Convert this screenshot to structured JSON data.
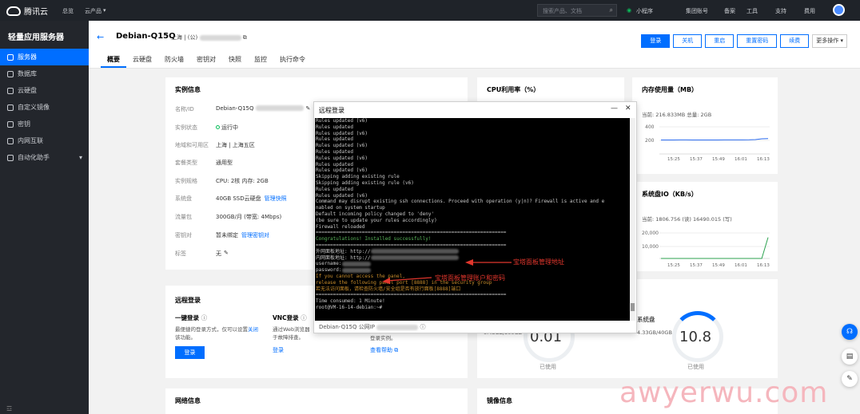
{
  "topbar": {
    "brand": "腾讯云",
    "nav": [
      "总览",
      "云产品"
    ],
    "search_placeholder": "搜索产品、文档",
    "right": [
      "小程序",
      "集团账号",
      "备案",
      "工具",
      "支持",
      "费用"
    ]
  },
  "sidebar": {
    "title": "轻量应用服务器",
    "items": [
      "服务器",
      "数据库",
      "云硬盘",
      "自定义镜像",
      "密钥",
      "内网互联",
      "自动化助手"
    ],
    "bottom": "☲"
  },
  "header": {
    "name": "Debian-Q15Q",
    "region_prefix": "上海 | (公)",
    "tabs": [
      "概要",
      "云硬盘",
      "防火墙",
      "密钥对",
      "快照",
      "监控",
      "执行命令"
    ],
    "actions": [
      "登录",
      "关机",
      "重启",
      "重置密码",
      "续费",
      "更多操作"
    ]
  },
  "instance_card": {
    "title": "实例信息",
    "rows": [
      {
        "k": "名称/ID",
        "v": "Debian-Q15Q"
      },
      {
        "k": "实例状态",
        "v": "运行中"
      },
      {
        "k": "地域和可用区",
        "v": "上海 | 上海五区"
      },
      {
        "k": "套餐类型",
        "v": "通用型"
      },
      {
        "k": "实例规格",
        "v": "CPU: 2核 内存: 2GB"
      },
      {
        "k": "系统盘",
        "v": "40GB SSD云硬盘",
        "link": "管理快照"
      },
      {
        "k": "流量包",
        "v": "300GB/月 (带宽: 4Mbps)"
      },
      {
        "k": "密钥对",
        "v": "暂未绑定",
        "link": "管理密钥对"
      },
      {
        "k": "标签",
        "v": "无"
      }
    ]
  },
  "cpu_card": {
    "title": "CPU利用率（%）"
  },
  "mem_card": {
    "title": "内存使用量（MB）",
    "current": "当前: 216.833MB 总量: 2GB",
    "ticks": [
      "400",
      "200"
    ],
    "xticks": [
      "15:25",
      "15:37",
      "15:49",
      "16:01",
      "16:13"
    ],
    "values": [
      206,
      206,
      206,
      207,
      207,
      206,
      206,
      206,
      206,
      206,
      207,
      207,
      207,
      207,
      208,
      212,
      224,
      226
    ]
  },
  "disk_card": {
    "title": "系统盘IO（KB/s）",
    "current": "当前: 1806.756 (读) 16490.015 (写)",
    "ticks": [
      "20,000",
      "10,000"
    ],
    "xticks": [
      "15:25",
      "15:37",
      "15:49",
      "16:01",
      "16:13"
    ],
    "values": [
      0,
      0,
      0,
      0,
      0,
      0,
      0,
      0,
      0,
      0,
      0,
      0,
      0,
      0,
      0,
      0,
      0,
      16490
    ]
  },
  "remote_card": {
    "title": "远程登录",
    "one_title": "一键登录",
    "one_desc": "最便捷的登录方式，仅可以设置",
    "one_link": "关闭",
    "one_desc2": "该功能。",
    "one_btn": "登录",
    "vnc_title": "VNC登录",
    "vnc_desc": "通过Web浏览器",
    "vnc_desc2": "于故障排查。",
    "vnc_link": "登录",
    "other_text": "登录实例。",
    "other_link": "查看帮助"
  },
  "usage": {
    "left_value": "0.01",
    "left_label": "已使用",
    "left_sub": "0.43GB/300GB",
    "right_title": "系统盘",
    "right_sub": "4.33GB/40GB",
    "right_value": "10.8",
    "right_label": "已使用"
  },
  "network_card": {
    "title": "网络信息"
  },
  "image_card": {
    "title": "镜像信息"
  },
  "terminal": {
    "title": "远程登录",
    "min": "—",
    "close": "✕",
    "footer": "Debian-Q15Q 公网IP",
    "lines": [
      "Rules updated (v6)",
      "Rules updated",
      "Rules updated (v6)",
      "Rules updated",
      "Rules updated (v6)",
      "Rules updated",
      "Rules updated (v6)",
      "Rules updated",
      "Rules updated (v6)",
      "Skipping adding existing rule",
      "Skipping adding existing rule (v6)",
      "Rules updated",
      "Rules updated (v6)",
      "Command may disrupt existing ssh connections. Proceed with operation (y|n)? Firewall is active and e",
      "nabled on system startup",
      "Default incoming policy changed to 'deny'",
      "(be sure to update your rules accordingly)",
      "Firewall reloaded"
    ],
    "sep": "==================================================================",
    "congrats": "Congratulations! Installed successfully!",
    "pub": "外网面板地址: http://",
    "priv": "内网面板地址: http://",
    "user": "username:",
    "pass": "password:",
    "warn1": "If you cannot access the panel,",
    "warn2": "release the following panel port [8888] in the security group",
    "warn3": "若无法访问面板，请检查防火墙/安全组是否有放行面板[8888]端口",
    "time": "Time consumed: 1 Minute!",
    "prompt": "root@VM-16-14-debian:~#"
  },
  "annotations": {
    "panel": "宝塔面板管理地址",
    "account": "宝塔面板管理账户和密码"
  },
  "watermark": "awyerwu.com"
}
